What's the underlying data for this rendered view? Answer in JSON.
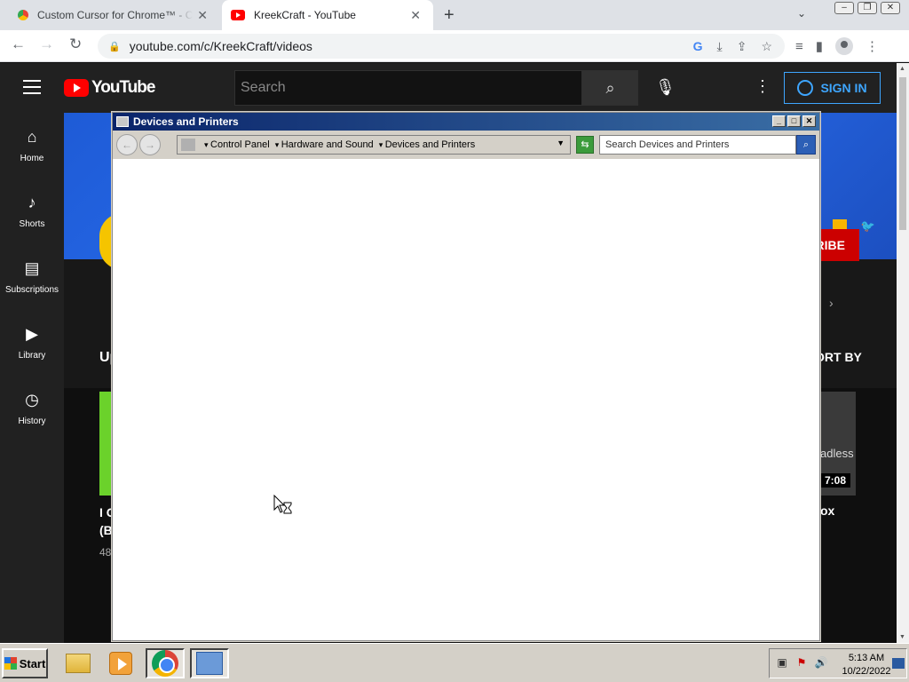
{
  "browser": {
    "tabs": [
      {
        "title": "Custom Cursor for Chrome™ - Chrome Web Store",
        "favicon": "custom-cursor-icon",
        "active": false
      },
      {
        "title": "KreekCraft - YouTube",
        "favicon": "youtube-icon",
        "active": true
      }
    ],
    "new_tab": "+",
    "url": "youtube.com/c/KreekCraft/videos"
  },
  "youtube": {
    "logo": "YouTube",
    "search_placeholder": "Search",
    "sign_in": "SIGN IN",
    "sidebar": [
      {
        "label": "Home",
        "icon": "home-icon"
      },
      {
        "label": "Shorts",
        "icon": "shorts-icon"
      },
      {
        "label": "Subscriptions",
        "icon": "subscriptions-icon"
      },
      {
        "label": "Library",
        "icon": "library-icon"
      },
      {
        "label": "History",
        "icon": "history-icon"
      }
    ],
    "subscribe_partial": "RIBE",
    "uploads_partial": "Up",
    "sort_by_partial": "ORT BY",
    "video1_title_partial": "I C",
    "video1_title_line2": "(B",
    "video1_views_partial": "48",
    "video2_thumb_text": "adless",
    "video2_duration": "7:08",
    "video2_title_partial": "ox"
  },
  "explorer": {
    "title": "Devices and Printers",
    "breadcrumbs": [
      "Control Panel",
      "Hardware and Sound",
      "Devices and Printers"
    ],
    "search_placeholder": "Search Devices and Printers"
  },
  "taskbar": {
    "start": "Start",
    "time": "5:13 AM",
    "date": "10/22/2022"
  },
  "colors": {
    "yt_red": "#ff0000",
    "signin_blue": "#3ea6ff",
    "title_bar": "#0a246a",
    "banner_blue": "#2a6ff0"
  }
}
